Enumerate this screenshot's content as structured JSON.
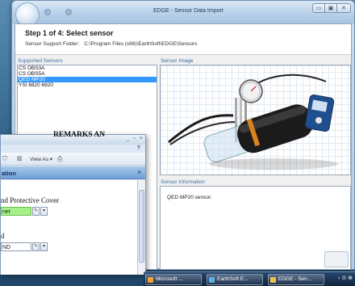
{
  "main_window": {
    "title": "EDGE - Sensor Data Import",
    "caption_buttons": {
      "minimize": "▭",
      "maximize": "▣",
      "close": "✕"
    }
  },
  "wizard": {
    "step_title": "Step 1 of 4: Select sensor",
    "folder_label": "Sensor Support Folder:",
    "folder_path": "C:\\Program Files (x86)\\EarthSoft\\EDGE\\Sensors"
  },
  "supported_sensors": {
    "label": "Supported Sensors",
    "items": [
      {
        "label": "CS OBS3A",
        "selected": false
      },
      {
        "label": "CS OBS5A",
        "selected": false
      },
      {
        "label": "QED MP20",
        "selected": true
      },
      {
        "label": "YSI 6820 6920",
        "selected": false
      }
    ]
  },
  "sensor_image": {
    "label": "Sensor Image"
  },
  "sensor_information": {
    "label": "Sensor Information",
    "text": "QED MP20 sensor."
  },
  "doc_window": {
    "caption": {
      "minimize": "_",
      "maximize": "▫",
      "close": "×"
    },
    "help": "?",
    "toolbar": {
      "view_as": "View As ▾"
    },
    "task_pane": {
      "title": "ation",
      "close": "×"
    },
    "lines": {
      "cover": "nd Protective Cover",
      "field1_value": "ner",
      "line_d": "d",
      "field2_value": "ND",
      "remarks": "REMARKS AN"
    }
  },
  "taskbar": {
    "items": [
      {
        "label": "Microsoft ...",
        "icon_color": "#e8a23a"
      },
      {
        "label": "EarthSoft E...",
        "icon_color": "#5ab0e8"
      },
      {
        "label": "EDGE - Sen...",
        "icon_color": "#f0c14a"
      }
    ],
    "tray": "‹ ⊙ ⊕"
  }
}
